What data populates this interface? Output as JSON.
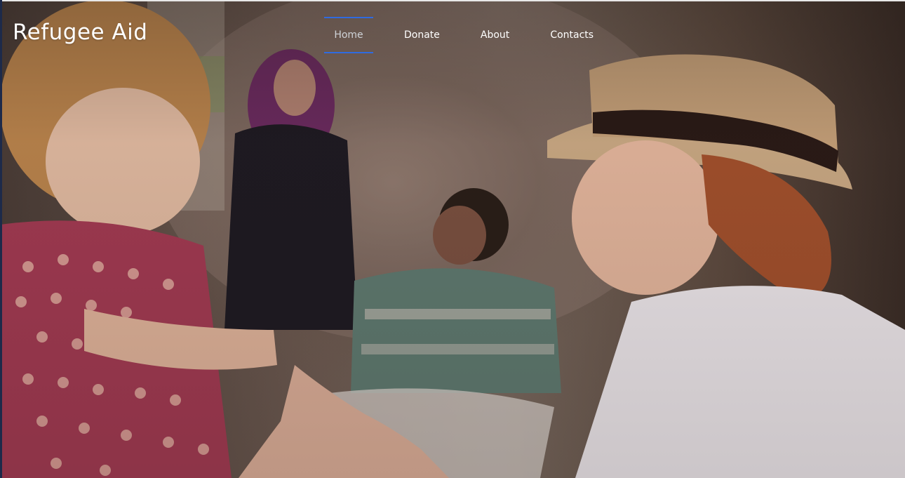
{
  "brand": {
    "title": "Refugee Aid"
  },
  "nav": {
    "items": [
      {
        "label": "Home",
        "active": true
      },
      {
        "label": "Donate",
        "active": false
      },
      {
        "label": "About",
        "active": false
      },
      {
        "label": "Contacts",
        "active": false
      }
    ],
    "active_color": "#2f6be0"
  },
  "hero": {
    "image_subject": "aid-worker-with-child-photo"
  }
}
